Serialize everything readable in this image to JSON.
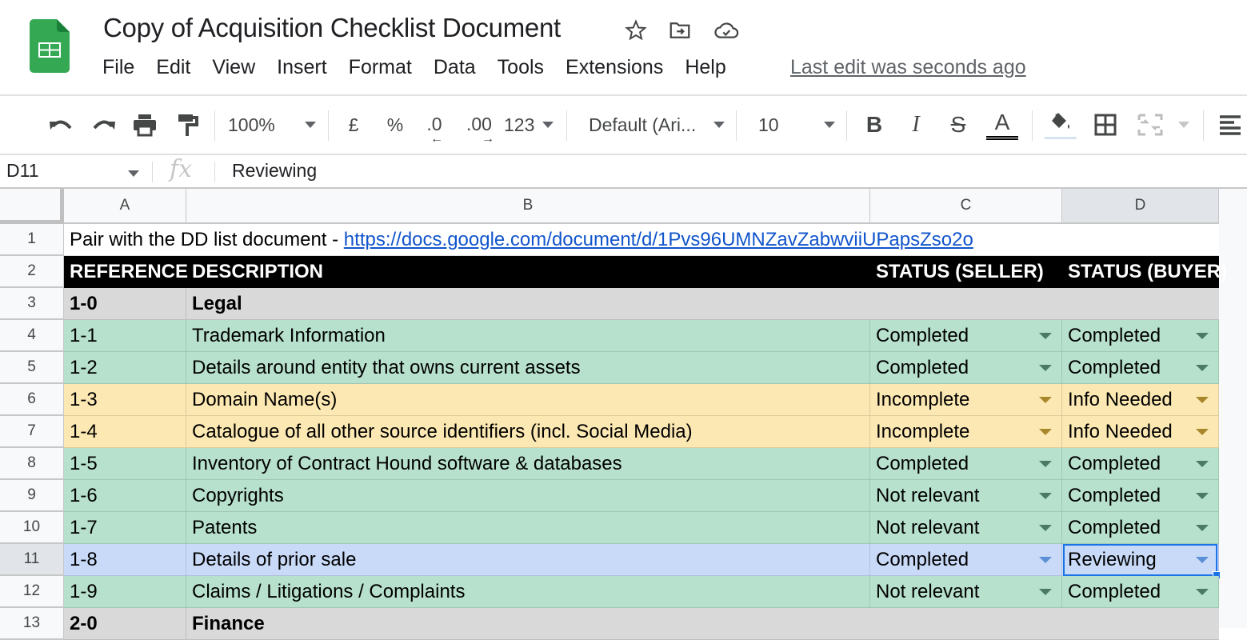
{
  "app": {
    "title": "Copy of Acquisition Checklist Document",
    "last_edit": "Last edit was seconds ago",
    "title_icons": [
      "star-icon",
      "move-to-folder-icon",
      "cloud-saved-icon"
    ],
    "menu": [
      "File",
      "Edit",
      "View",
      "Insert",
      "Format",
      "Data",
      "Tools",
      "Extensions",
      "Help"
    ]
  },
  "toolbar": {
    "zoom": "100%",
    "currency": "£",
    "percent": "%",
    "decrease_decimal": ".0",
    "increase_decimal": ".00",
    "number_format": "123",
    "font": "Default (Ari...",
    "font_size": "10",
    "bold": "B",
    "italic": "I",
    "strikethrough": "S",
    "text_color": "A"
  },
  "formula_bar": {
    "cell_ref": "D11",
    "fx": "fx",
    "value": "Reviewing"
  },
  "columns": [
    "A",
    "B",
    "C",
    "D"
  ],
  "selected_cell": "D11",
  "colors": {
    "header_bg": "#000000",
    "section_bg": "#d9d9d9",
    "completed_bg": "#b7e1cd",
    "incomplete_bg": "#fce8b2",
    "selected_row_bg": "#c9daf8",
    "selection_border": "#1a73e8",
    "link": "#1155cc"
  },
  "rows": [
    {
      "num": "1",
      "type": "note",
      "text": "Pair with the DD list document - ",
      "link": "https://docs.google.com/document/d/1Pvs96UMNZavZabwviiUPapsZso2o"
    },
    {
      "num": "2",
      "type": "header",
      "ref": "REFERENCE",
      "desc": "DESCRIPTION",
      "seller": "STATUS (SELLER)",
      "buyer": "STATUS (BUYER)"
    },
    {
      "num": "3",
      "type": "section",
      "ref": "1-0",
      "desc": "Legal"
    },
    {
      "num": "4",
      "type": "item",
      "status_class": "green",
      "ref": "1-1",
      "desc": "Trademark Information",
      "seller": "Completed",
      "buyer": "Completed"
    },
    {
      "num": "5",
      "type": "item",
      "status_class": "green",
      "ref": "1-2",
      "desc": "Details around entity that owns current assets",
      "seller": "Completed",
      "buyer": "Completed"
    },
    {
      "num": "6",
      "type": "item",
      "status_class": "yellow",
      "ref": "1-3",
      "desc": "Domain Name(s)",
      "seller": "Incomplete",
      "buyer": "Info Needed"
    },
    {
      "num": "7",
      "type": "item",
      "status_class": "yellow",
      "ref": "1-4",
      "desc": "Catalogue of all other source identifiers (incl. Social Media)",
      "seller": "Incomplete",
      "buyer": "Info Needed"
    },
    {
      "num": "8",
      "type": "item",
      "status_class": "green",
      "ref": "1-5",
      "desc": "Inventory of Contract Hound software & databases",
      "seller": "Completed",
      "buyer": "Completed"
    },
    {
      "num": "9",
      "type": "item",
      "status_class": "green",
      "ref": "1-6",
      "desc": "Copyrights",
      "seller": "Not relevant",
      "buyer": "Completed"
    },
    {
      "num": "10",
      "type": "item",
      "status_class": "green",
      "ref": "1-7",
      "desc": "Patents",
      "seller": "Not relevant",
      "buyer": "Completed"
    },
    {
      "num": "11",
      "type": "item",
      "status_class": "blue",
      "ref": "1-8",
      "desc": "Details of prior sale",
      "seller": "Completed",
      "buyer": "Reviewing"
    },
    {
      "num": "12",
      "type": "item",
      "status_class": "green",
      "ref": "1-9",
      "desc": "Claims / Litigations / Complaints",
      "seller": "Not relevant",
      "buyer": "Completed"
    },
    {
      "num": "13",
      "type": "section",
      "ref": "2-0",
      "desc": "Finance"
    }
  ]
}
